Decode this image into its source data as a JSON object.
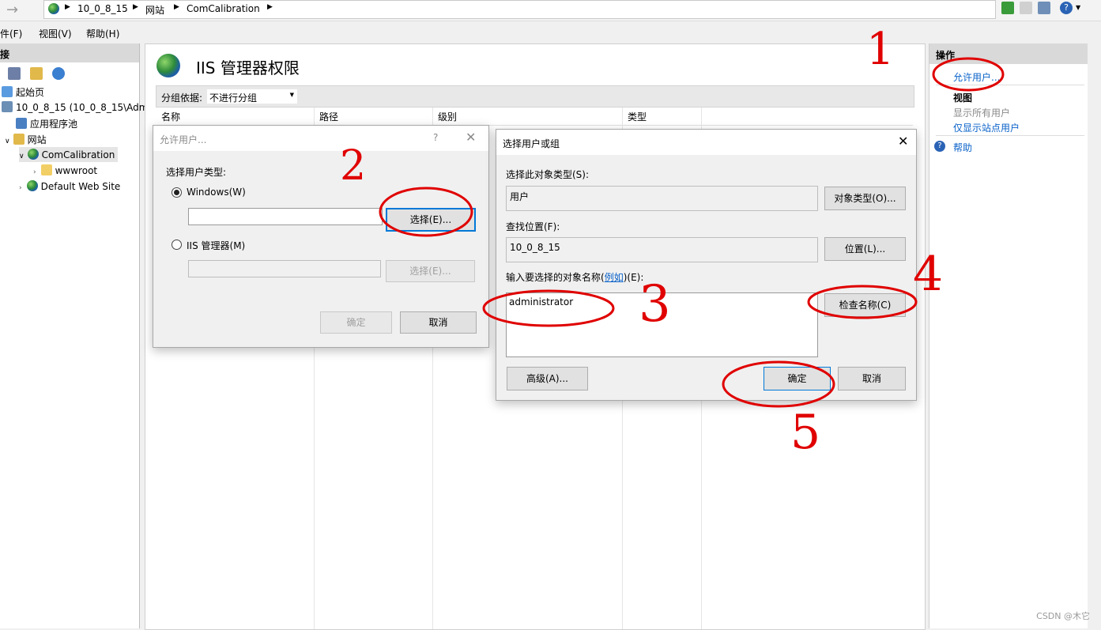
{
  "address": {
    "crumbs": [
      "10_0_8_15",
      "网站",
      "ComCalibration"
    ]
  },
  "menu": [
    "文件(F)",
    "视图(V)",
    "帮助(H)"
  ],
  "left_panel": {
    "header": "连接",
    "tree": [
      {
        "label": "起始页",
        "icon": "start-page-icon"
      },
      {
        "label": "10_0_8_15 (10_0_8_15\\Adm",
        "icon": "server-icon"
      },
      {
        "label": "应用程序池",
        "icon": "app-pool-icon"
      },
      {
        "label": "网站",
        "icon": "sites-folder-icon"
      },
      {
        "label": "ComCalibration",
        "icon": "globe-icon"
      },
      {
        "label": "wwwroot",
        "icon": "folder-icon"
      },
      {
        "label": "Default Web Site",
        "icon": "globe-icon"
      }
    ]
  },
  "center": {
    "title": "IIS 管理器权限",
    "group_label": "分组依据:",
    "group_value": "不进行分组",
    "columns": [
      "名称",
      "路径",
      "级别",
      "类型"
    ]
  },
  "right_panel": {
    "header": "操作",
    "allow_user": "允许用户...",
    "view_section": "视图",
    "show_all": "显示所有用户",
    "show_site": "仅显示站点用户",
    "help": "帮助"
  },
  "dialog_allow": {
    "title": "允许用户...",
    "help_char": "?",
    "user_type_label": "选择用户类型:",
    "windows_option": "Windows(W)",
    "windows_value": "",
    "select_button": "选择(E)...",
    "iis_option": "IIS 管理器(M)",
    "iis_select_button": "选择(E)...",
    "ok": "确定",
    "cancel": "取消"
  },
  "dialog_select": {
    "title": "选择用户或组",
    "object_type_label": "选择此对象类型(S):",
    "object_type_value": "用户",
    "object_type_button": "对象类型(O)...",
    "location_label": "查找位置(F):",
    "location_value": "10_0_8_15",
    "location_button": "位置(L)...",
    "names_label_pre": "输入要选择的对象名称(",
    "names_label_link": "例如",
    "names_label_post": ")(E):",
    "names_value": "administrator",
    "check_names_button": "检查名称(C)",
    "advanced_button": "高级(A)...",
    "ok": "确定",
    "cancel": "取消"
  },
  "annotations": [
    "1",
    "2",
    "3",
    "4",
    "5"
  ],
  "watermark": "CSDN @木它",
  "colors": {
    "link": "#0a62c9",
    "annotation": "#e00000",
    "focus": "#0078d7"
  }
}
